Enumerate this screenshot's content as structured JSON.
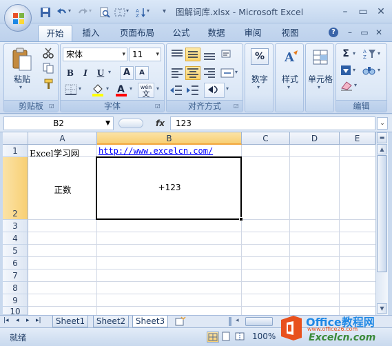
{
  "window": {
    "title": "图解词库.xlsx - Microsoft Excel",
    "qa_sep": "▾"
  },
  "ribbon_tabs": [
    "开始",
    "插入",
    "页面布局",
    "公式",
    "数据",
    "审阅",
    "视图"
  ],
  "clipboard": {
    "paste_label": "粘贴",
    "group_label": "剪贴板"
  },
  "font_group": {
    "font_name": "宋体",
    "font_size": "11",
    "bold": "B",
    "italic": "I",
    "underline": "U",
    "grow": "A",
    "shrink": "A",
    "wen": "wén",
    "wen_char": "文",
    "group_label": "字体"
  },
  "align_group": {
    "group_label": "对齐方式"
  },
  "number_group": {
    "label": "数字",
    "symbol": "%"
  },
  "styles_group": {
    "label": "样式"
  },
  "cells_group": {
    "label": "单元格"
  },
  "edit_group": {
    "group_label": "编辑",
    "sigma": "Σ"
  },
  "formula_bar": {
    "name_box": "B2",
    "fx": "fx",
    "content": "123"
  },
  "sheet": {
    "columns": [
      "A",
      "B",
      "C",
      "D",
      "E"
    ],
    "rows": [
      "1",
      "2",
      "3",
      "4",
      "5",
      "6",
      "7",
      "8",
      "9",
      "10"
    ],
    "cells": {
      "A1": "Excel学习网",
      "B1": "http://www.excelcn.com/",
      "A2": "正数",
      "B2": "+123"
    }
  },
  "sheet_tabs": [
    "Sheet1",
    "Sheet2",
    "Sheet3"
  ],
  "status": {
    "ready": "就绪",
    "zoom": "100%"
  },
  "watermark": {
    "line1": "Office教程网",
    "line2": "www.office26.com",
    "line3": "Excelcn.com"
  },
  "colors": {
    "accent": "#f2a53b",
    "selection_border": "#000000",
    "link": "#0000ff"
  }
}
